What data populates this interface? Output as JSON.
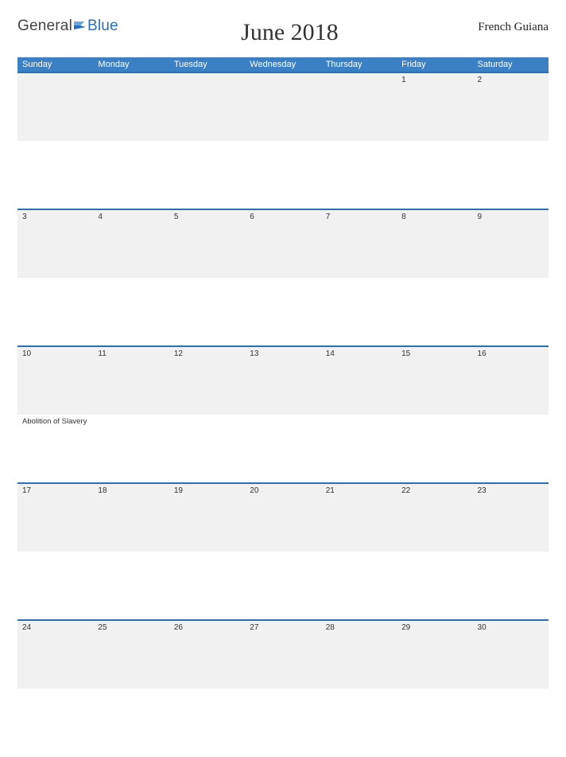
{
  "brand": {
    "general": "General",
    "blue": "Blue"
  },
  "title": "June 2018",
  "region": "French Guiana",
  "weekdays": [
    "Sunday",
    "Monday",
    "Tuesday",
    "Wednesday",
    "Thursday",
    "Friday",
    "Saturday"
  ],
  "weeks": [
    {
      "days": [
        {
          "num": "",
          "event": ""
        },
        {
          "num": "",
          "event": ""
        },
        {
          "num": "",
          "event": ""
        },
        {
          "num": "",
          "event": ""
        },
        {
          "num": "",
          "event": ""
        },
        {
          "num": "1",
          "event": ""
        },
        {
          "num": "2",
          "event": ""
        }
      ]
    },
    {
      "days": [
        {
          "num": "3",
          "event": ""
        },
        {
          "num": "4",
          "event": ""
        },
        {
          "num": "5",
          "event": ""
        },
        {
          "num": "6",
          "event": ""
        },
        {
          "num": "7",
          "event": ""
        },
        {
          "num": "8",
          "event": ""
        },
        {
          "num": "9",
          "event": ""
        }
      ]
    },
    {
      "days": [
        {
          "num": "10",
          "event": "Abolition of Slavery"
        },
        {
          "num": "11",
          "event": ""
        },
        {
          "num": "12",
          "event": ""
        },
        {
          "num": "13",
          "event": ""
        },
        {
          "num": "14",
          "event": ""
        },
        {
          "num": "15",
          "event": ""
        },
        {
          "num": "16",
          "event": ""
        }
      ]
    },
    {
      "days": [
        {
          "num": "17",
          "event": ""
        },
        {
          "num": "18",
          "event": ""
        },
        {
          "num": "19",
          "event": ""
        },
        {
          "num": "20",
          "event": ""
        },
        {
          "num": "21",
          "event": ""
        },
        {
          "num": "22",
          "event": ""
        },
        {
          "num": "23",
          "event": ""
        }
      ]
    },
    {
      "days": [
        {
          "num": "24",
          "event": ""
        },
        {
          "num": "25",
          "event": ""
        },
        {
          "num": "26",
          "event": ""
        },
        {
          "num": "27",
          "event": ""
        },
        {
          "num": "28",
          "event": ""
        },
        {
          "num": "29",
          "event": ""
        },
        {
          "num": "30",
          "event": ""
        }
      ]
    }
  ]
}
